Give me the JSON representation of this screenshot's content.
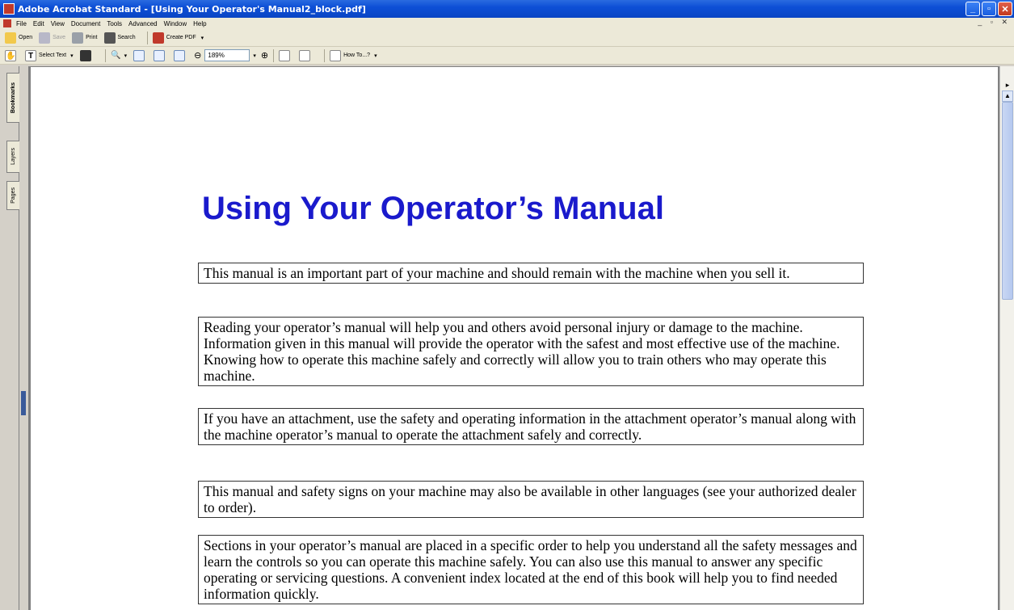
{
  "window": {
    "title": "Adobe Acrobat Standard - [Using Your Operator's Manual2_block.pdf]",
    "minimize": "_",
    "maximize": "▫",
    "close": "✕"
  },
  "menu": {
    "items": [
      "File",
      "Edit",
      "View",
      "Document",
      "Tools",
      "Advanced",
      "Window",
      "Help"
    ],
    "mdi_controls": "_ ▫ ✕"
  },
  "toolbar1": {
    "open": "Open",
    "save": "Save",
    "print": "Print",
    "search": "Search",
    "create_pdf": "Create PDF",
    "dropdown": "▾"
  },
  "toolbar2": {
    "select_text": "Select Text",
    "zoom": "189%",
    "how_to": "How To...?",
    "dropdown": "▾",
    "zoom_out": "⊖",
    "zoom_in": "⊕"
  },
  "nav_tabs": [
    "Bookmarks",
    "Layers",
    "Pages"
  ],
  "document": {
    "title": "Using Your Operator’s Manual",
    "paragraphs": [
      "This manual is an important part of your machine and should remain with the machine when you sell it.",
      "Reading your operator’s manual will help you and others avoid personal injury or damage to the machine. Information given in this manual will provide the operator with the safest and most effective use of the machine. Knowing how to operate this machine safely and correctly will allow you to train others who may operate this machine.",
      "If you have an attachment, use the safety and operating information in the attachment operator’s manual along with the machine operator’s manual to operate the attachment safely and correctly.",
      "This manual and safety signs on your machine may also be available in other languages (see your authorized dealer to order).",
      "Sections in your operator’s manual are placed in a specific order to help you understand all the safety messages and learn the controls so you can operate this machine safely. You can also use this manual to answer any specific operating or servicing questions. A convenient index located at the end of this book will help you to find needed information quickly."
    ]
  },
  "colors": {
    "title_blue": "#1a1acc",
    "titlebar_blue": "#0d4fd6"
  }
}
